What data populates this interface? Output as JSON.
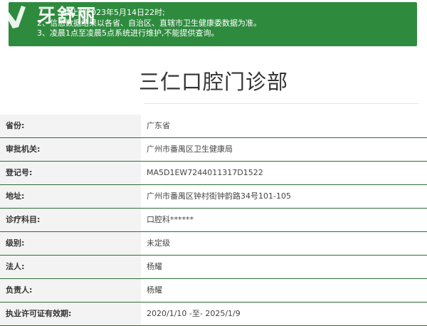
{
  "notice": {
    "lines": [
      "截止到2023年5月14日22时;",
      "2、信息数据结果以各省、自治区、直辖市卫生健康委数据为准。",
      "3、凌晨1点至凌晨5点系统进行维护,不能提供查询。"
    ],
    "background_color": "#2e8b3e"
  },
  "logo": {
    "text": "牙舒丽",
    "icon": "brand-logo-icon"
  },
  "title": "三仁口腔门诊部",
  "rows": [
    {
      "label": "省份:",
      "value": "广东省"
    },
    {
      "label": "审批机关:",
      "value": "广州市番禺区卫生健康局"
    },
    {
      "label": "登记号:",
      "value": "MA5D1EW7244011317D1522"
    },
    {
      "label": "地址:",
      "value": "广州市番禺区钟村街钟韵路34号101-105"
    },
    {
      "label": "诊疗科目:",
      "value": "口腔科******"
    },
    {
      "label": "级别:",
      "value": "未定级"
    },
    {
      "label": "法人:",
      "value": "杨耀"
    },
    {
      "label": "负责人:",
      "value": "杨耀"
    },
    {
      "label": "执业许可证有效期:",
      "value": "2020/1/10 -至- 2025/1/9"
    }
  ],
  "colors": {
    "accent_green": "#2e8b3e",
    "row_divider": "#2e6b3a",
    "label_background": "#f3f3f3"
  }
}
